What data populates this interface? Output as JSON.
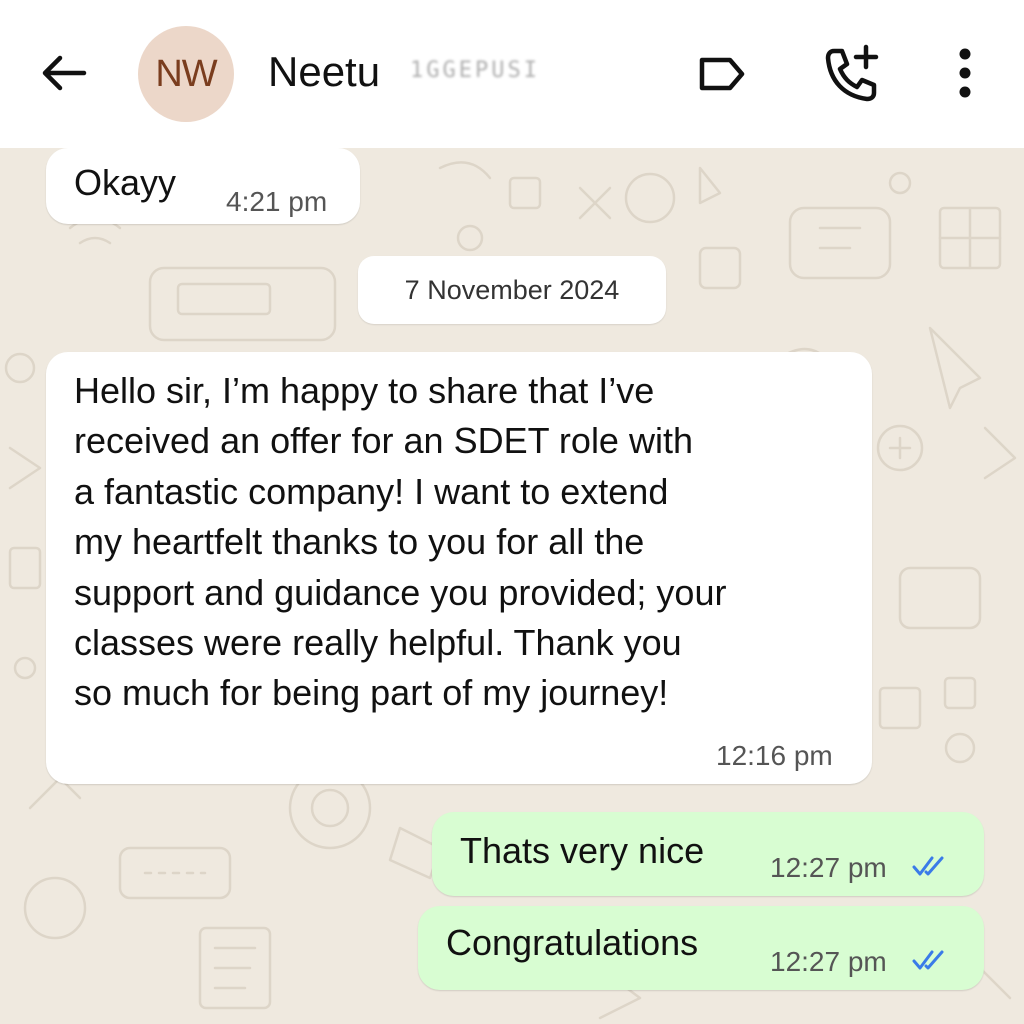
{
  "header": {
    "avatar_initials": "NW",
    "contact_name": "Neetu",
    "contact_subtitle": "1GGEPUSI",
    "icons": [
      "back-arrow-icon",
      "label-icon",
      "add-call-icon",
      "more-vertical-icon"
    ]
  },
  "chat": {
    "date_separator": "7 November 2024",
    "messages": [
      {
        "direction": "incoming",
        "text": "Okayy",
        "time": "4:21 pm"
      },
      {
        "direction": "incoming",
        "lines": [
          "Hello sir, I’m happy to share that I’ve",
          "received an offer for an SDET role with",
          "a fantastic company! I want to extend",
          "my heartfelt thanks to you for all the",
          "support and guidance you provided; your",
          "classes were really helpful. Thank you",
          "so much for being part of my journey!"
        ],
        "time": "12:16 pm"
      },
      {
        "direction": "outgoing",
        "text": "Thats very nice",
        "time": "12:27 pm",
        "status": "read"
      },
      {
        "direction": "outgoing",
        "text": "Congratulations",
        "time": "12:27 pm",
        "status": "read"
      }
    ]
  },
  "colors": {
    "wallpaper": "#efe9df",
    "incoming_bubble": "#ffffff",
    "outgoing_bubble": "#d8fdd2",
    "read_ticks": "#3a7be8",
    "avatar_bg": "#ecd7c9",
    "avatar_text": "#7a3d1e"
  }
}
